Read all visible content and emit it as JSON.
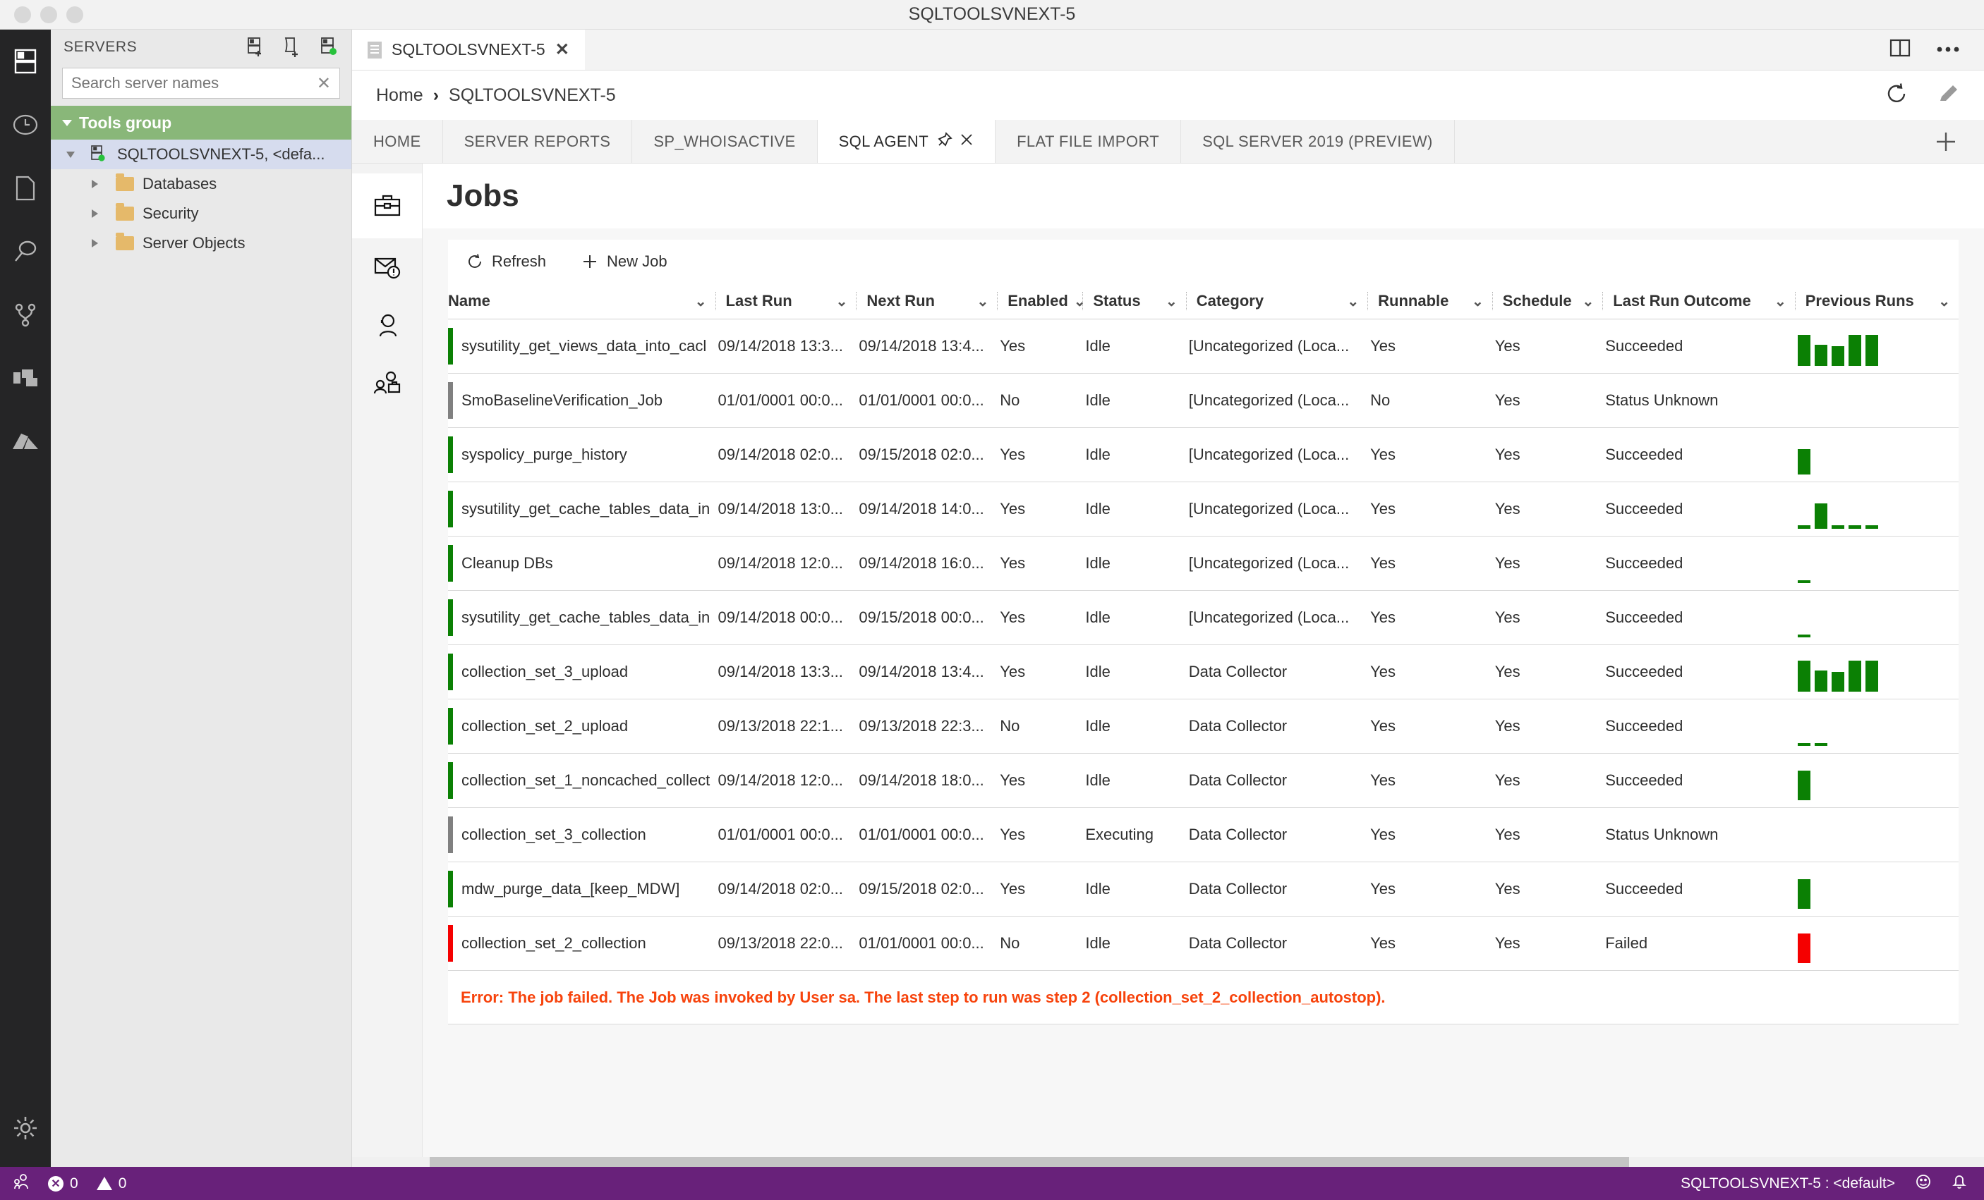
{
  "window": {
    "title": "SQLTOOLSVNEXT-5"
  },
  "sidebar": {
    "header": "SERVERS",
    "actions": [
      "new-connection-icon",
      "new-server-group-icon",
      "connected-server-icon"
    ],
    "search": {
      "placeholder": "Search server names",
      "value": "",
      "clear": "✕"
    },
    "group": {
      "label": "Tools group"
    },
    "server": {
      "label": "SQLTOOLSVNEXT-5, <defa..."
    },
    "nodes": [
      {
        "label": "Databases"
      },
      {
        "label": "Security"
      },
      {
        "label": "Server Objects"
      }
    ]
  },
  "editor_tab": {
    "label": "SQLTOOLSVNEXT-5",
    "close": "✕"
  },
  "breadcrumb": {
    "home": "Home",
    "separator": "›",
    "current": "SQLTOOLSVNEXT-5"
  },
  "dashboard_tabs": [
    {
      "label": "HOME",
      "active": false
    },
    {
      "label": "SERVER REPORTS",
      "active": false
    },
    {
      "label": "SP_WHOISACTIVE",
      "active": false
    },
    {
      "label": "SQL AGENT",
      "active": true
    },
    {
      "label": "FLAT FILE IMPORT",
      "active": false
    },
    {
      "label": "SQL SERVER 2019 (PREVIEW)",
      "active": false
    }
  ],
  "panel": {
    "title": "Jobs",
    "toolbar": {
      "refresh": "Refresh",
      "new_job": "New Job"
    },
    "rail_icons": [
      "jobs-briefcase-icon",
      "alerts-envelope-icon",
      "operators-person-icon",
      "proxies-people-icon"
    ]
  },
  "grid": {
    "columns": [
      "Name",
      "Last Run",
      "Next Run",
      "Enabled",
      "Status",
      "Category",
      "Runnable",
      "Schedule",
      "Last Run Outcome",
      "Previous Runs"
    ],
    "rows": [
      {
        "accent": "#0b8004",
        "name": "sysutility_get_views_data_into_cacl",
        "last_run": "09/14/2018 13:3...",
        "next_run": "09/14/2018 13:4...",
        "enabled": "Yes",
        "status": "Idle",
        "category": "[Uncategorized (Loca...",
        "runnable": "Yes",
        "schedule": "Yes",
        "outcome": "Succeeded",
        "previous_runs": [
          44,
          30,
          28,
          44,
          44
        ],
        "previous_runs_color": "green"
      },
      {
        "accent": "#808080",
        "name": "SmoBaselineVerification_Job",
        "last_run": "01/01/0001 00:0...",
        "next_run": "01/01/0001 00:0...",
        "enabled": "No",
        "status": "Idle",
        "category": "[Uncategorized (Loca...",
        "runnable": "No",
        "schedule": "Yes",
        "outcome": "Status Unknown",
        "previous_runs": [],
        "previous_runs_color": "green"
      },
      {
        "accent": "#0b8004",
        "name": "syspolicy_purge_history",
        "last_run": "09/14/2018 02:0...",
        "next_run": "09/15/2018 02:0...",
        "enabled": "Yes",
        "status": "Idle",
        "category": "[Uncategorized (Loca...",
        "runnable": "Yes",
        "schedule": "Yes",
        "outcome": "Succeeded",
        "previous_runs": [
          36
        ],
        "previous_runs_color": "green"
      },
      {
        "accent": "#0b8004",
        "name": "sysutility_get_cache_tables_data_in",
        "last_run": "09/14/2018 13:0...",
        "next_run": "09/14/2018 14:0...",
        "enabled": "Yes",
        "status": "Idle",
        "category": "[Uncategorized (Loca...",
        "runnable": "Yes",
        "schedule": "Yes",
        "outcome": "Succeeded",
        "previous_runs": [
          5,
          36,
          5,
          5,
          5
        ],
        "previous_runs_color": "green"
      },
      {
        "accent": "#0b8004",
        "name": "Cleanup DBs",
        "last_run": "09/14/2018 12:0...",
        "next_run": "09/14/2018 16:0...",
        "enabled": "Yes",
        "status": "Idle",
        "category": "[Uncategorized (Loca...",
        "runnable": "Yes",
        "schedule": "Yes",
        "outcome": "Succeeded",
        "previous_runs": [
          4
        ],
        "previous_runs_color": "green"
      },
      {
        "accent": "#0b8004",
        "name": "sysutility_get_cache_tables_data_in",
        "last_run": "09/14/2018 00:0...",
        "next_run": "09/15/2018 00:0...",
        "enabled": "Yes",
        "status": "Idle",
        "category": "[Uncategorized (Loca...",
        "runnable": "Yes",
        "schedule": "Yes",
        "outcome": "Succeeded",
        "previous_runs": [
          4
        ],
        "previous_runs_color": "green"
      },
      {
        "accent": "#0b8004",
        "name": "collection_set_3_upload",
        "last_run": "09/14/2018 13:3...",
        "next_run": "09/14/2018 13:4...",
        "enabled": "Yes",
        "status": "Idle",
        "category": "Data Collector",
        "runnable": "Yes",
        "schedule": "Yes",
        "outcome": "Succeeded",
        "previous_runs": [
          44,
          30,
          28,
          44,
          44
        ],
        "previous_runs_color": "green"
      },
      {
        "accent": "#0b8004",
        "name": "collection_set_2_upload",
        "last_run": "09/13/2018 22:1...",
        "next_run": "09/13/2018 22:3...",
        "enabled": "No",
        "status": "Idle",
        "category": "Data Collector",
        "runnable": "Yes",
        "schedule": "Yes",
        "outcome": "Succeeded",
        "previous_runs": [
          4,
          4
        ],
        "previous_runs_color": "green"
      },
      {
        "accent": "#0b8004",
        "name": "collection_set_1_noncached_collect",
        "last_run": "09/14/2018 12:0...",
        "next_run": "09/14/2018 18:0...",
        "enabled": "Yes",
        "status": "Idle",
        "category": "Data Collector",
        "runnable": "Yes",
        "schedule": "Yes",
        "outcome": "Succeeded",
        "previous_runs": [
          42
        ],
        "previous_runs_color": "green"
      },
      {
        "accent": "#808080",
        "name": "collection_set_3_collection",
        "last_run": "01/01/0001 00:0...",
        "next_run": "01/01/0001 00:0...",
        "enabled": "Yes",
        "status": "Executing",
        "category": "Data Collector",
        "runnable": "Yes",
        "schedule": "Yes",
        "outcome": "Status Unknown",
        "previous_runs": [],
        "previous_runs_color": "green"
      },
      {
        "accent": "#0b8004",
        "name": "mdw_purge_data_[keep_MDW]",
        "last_run": "09/14/2018 02:0...",
        "next_run": "09/15/2018 02:0...",
        "enabled": "Yes",
        "status": "Idle",
        "category": "Data Collector",
        "runnable": "Yes",
        "schedule": "Yes",
        "outcome": "Succeeded",
        "previous_runs": [
          42
        ],
        "previous_runs_color": "green"
      },
      {
        "accent": "#f50000",
        "name": "collection_set_2_collection",
        "last_run": "09/13/2018 22:0...",
        "next_run": "01/01/0001 00:0...",
        "enabled": "No",
        "status": "Idle",
        "category": "Data Collector",
        "runnable": "Yes",
        "schedule": "Yes",
        "outcome": "Failed",
        "previous_runs": [
          42
        ],
        "previous_runs_color": "red"
      }
    ],
    "error_message": "Error: The job failed. The Job was invoked by User sa. The last step to run was step 2 (collection_set_2_collection_autostop)."
  },
  "status_bar": {
    "errors": "0",
    "warnings": "0",
    "connection": "SQLTOOLSVNEXT-5 : <default>"
  },
  "colors": {
    "accent_purple": "#68217a",
    "group_green": "#89b779",
    "bar_green": "#0b8004",
    "bar_red": "#f50000",
    "error_text": "#f7430c",
    "selection": "#d6dcee"
  }
}
